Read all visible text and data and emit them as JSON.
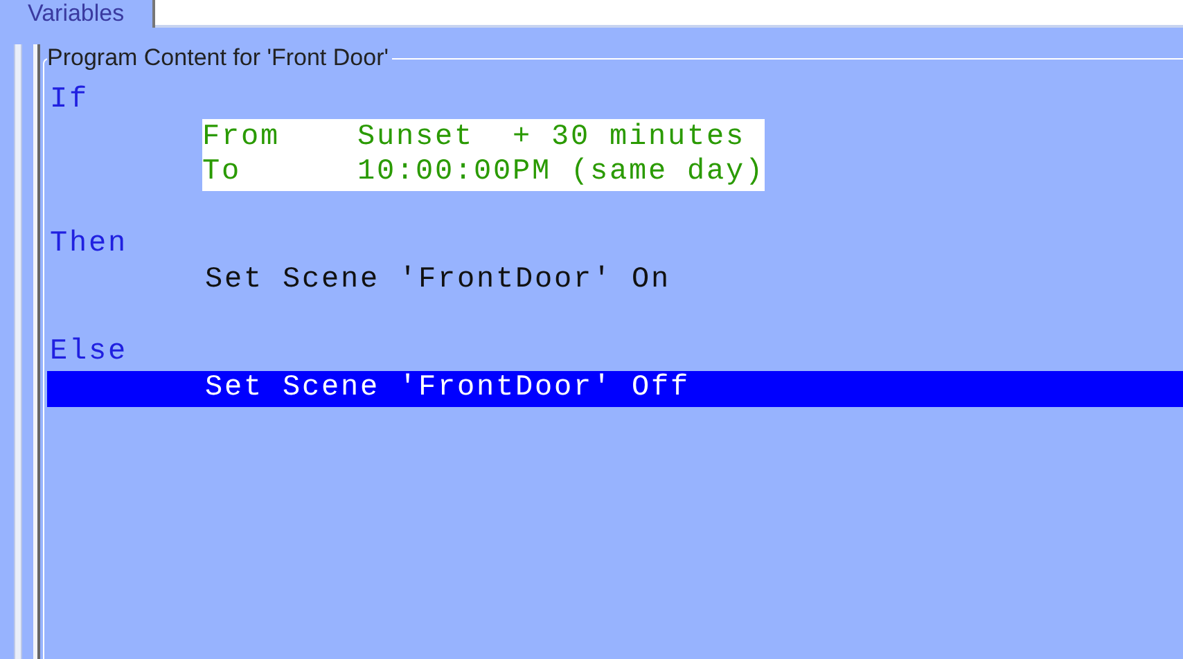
{
  "tab": {
    "label": "Variables",
    "selected": true
  },
  "group": {
    "title": "Program Content for 'Front Door'"
  },
  "lines": [
    {
      "kind": "keyword",
      "text": "If",
      "selected": false
    },
    {
      "kind": "condition",
      "field": "From",
      "value": "Sunset  + 30 minutes",
      "selected": false
    },
    {
      "kind": "condition",
      "field": "To",
      "value": "10:00:00PM (same day)",
      "selected": false
    },
    {
      "kind": "keyword",
      "text": "Then",
      "selected": false
    },
    {
      "kind": "action",
      "text": "Set Scene 'FrontDoor' On",
      "selected": false
    },
    {
      "kind": "keyword",
      "text": "Else",
      "selected": false
    },
    {
      "kind": "action",
      "text": "Set Scene 'FrontDoor' Off",
      "selected": true
    }
  ]
}
